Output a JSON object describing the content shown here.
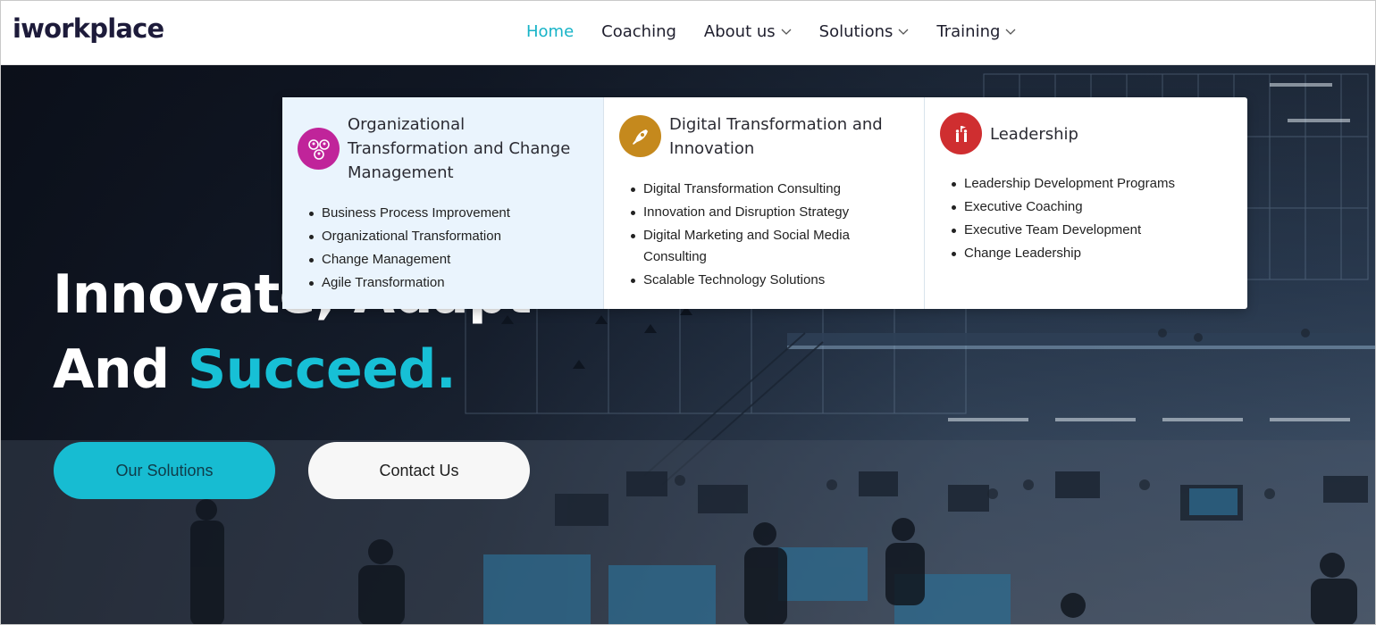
{
  "brand": {
    "logo_text": "iworkplace"
  },
  "nav": {
    "items": [
      {
        "label": "Home",
        "active": true,
        "has_dropdown": false
      },
      {
        "label": "Coaching",
        "active": false,
        "has_dropdown": false
      },
      {
        "label": "About us",
        "active": false,
        "has_dropdown": true
      },
      {
        "label": "Solutions",
        "active": false,
        "has_dropdown": true
      },
      {
        "label": "Training",
        "active": false,
        "has_dropdown": true
      }
    ]
  },
  "hero": {
    "headline_line1": "Innovate, Adapt",
    "headline_line2_prefix": "And ",
    "headline_line2_accent": "Succeed.",
    "primary_button": "Our Solutions",
    "secondary_button": "Contact Us"
  },
  "solutions_menu": {
    "columns": [
      {
        "title": "Organizational Transformation and Change Management",
        "icon": "people-network-icon",
        "icon_color": "#c0249a",
        "items": [
          "Business Process Improvement",
          "Organizational Transformation",
          "Change Management",
          "Agile Transformation"
        ]
      },
      {
        "title": "Digital Transformation and Innovation",
        "icon": "rocket-icon",
        "icon_color": "#c5891d",
        "items": [
          "Digital Transformation Consulting",
          "Innovation and Disruption Strategy",
          "Digital Marketing and Social Media Consulting",
          "Scalable Technology Solutions"
        ]
      },
      {
        "title": "Leadership",
        "icon": "leader-flag-icon",
        "icon_color": "#cf2e30",
        "items": [
          "Leadership Development Programs",
          "Executive Coaching",
          "Executive Team Development",
          "Change Leadership"
        ]
      }
    ]
  },
  "colors": {
    "accent": "#17bcd2",
    "text_dark": "#1d1b3a",
    "menu_highlight": "#eaf4fd"
  }
}
